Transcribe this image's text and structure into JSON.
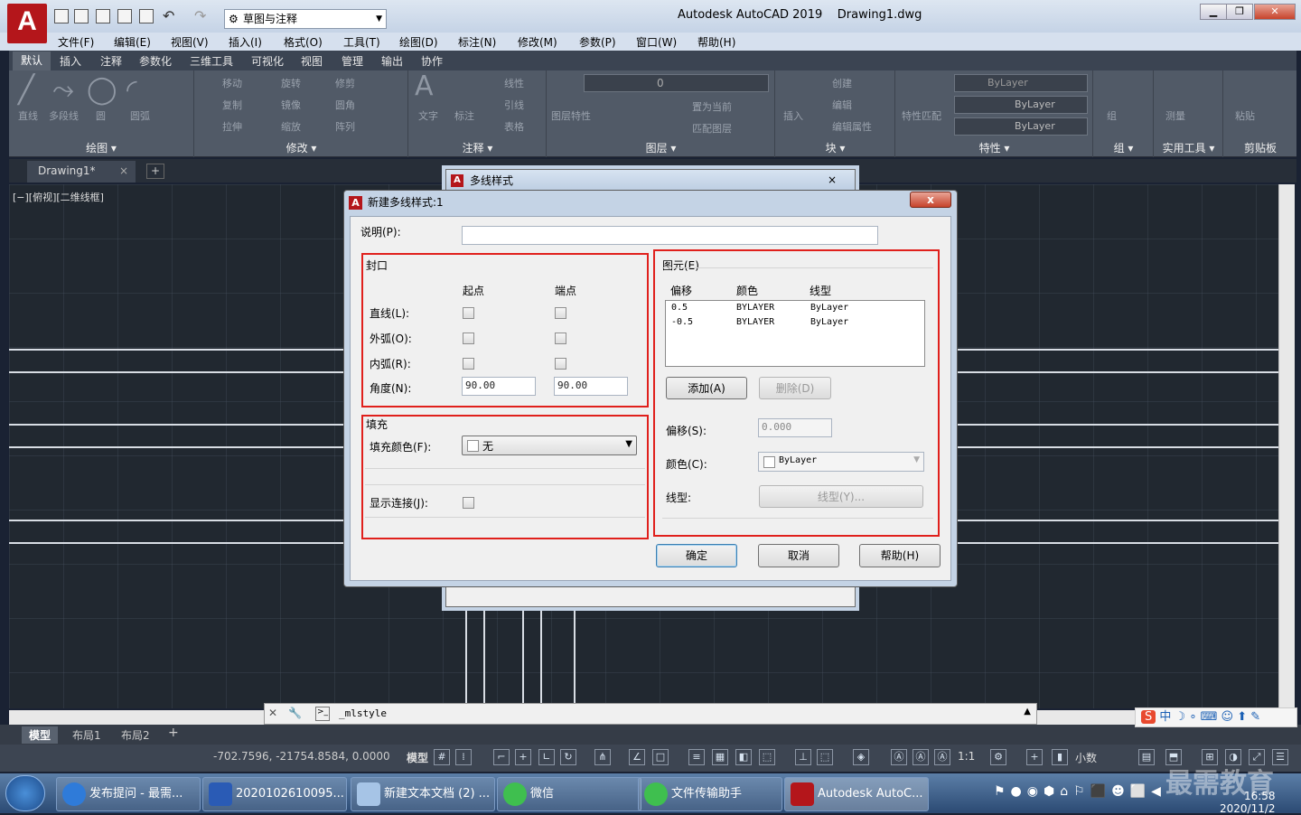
{
  "app": {
    "title": "Autodesk AutoCAD 2019",
    "file": "Drawing1.dwg",
    "logo": "A",
    "workspace": "草图与注释"
  },
  "menu": [
    "文件(F)",
    "编辑(E)",
    "视图(V)",
    "插入(I)",
    "格式(O)",
    "工具(T)",
    "绘图(D)",
    "标注(N)",
    "修改(M)",
    "参数(P)",
    "窗口(W)",
    "帮助(H)"
  ],
  "ribbon_tabs": [
    "默认",
    "插入",
    "注释",
    "参数化",
    "三维工具",
    "可视化",
    "视图",
    "管理",
    "输出",
    "协作"
  ],
  "ribbon_panels": {
    "draw": {
      "title": "绘图",
      "items": [
        "直线",
        "多段线",
        "圆",
        "圆弧"
      ]
    },
    "modify": {
      "title": "修改",
      "items": [
        "移动",
        "旋转",
        "修剪",
        "复制",
        "镜像",
        "圆角",
        "拉伸",
        "缩放",
        "阵列"
      ]
    },
    "annotation": {
      "title": "注释",
      "items": [
        "文字",
        "标注",
        "线性",
        "引线",
        "表格"
      ]
    },
    "layers": {
      "title": "图层",
      "current": "0",
      "items": [
        "图层特性",
        "置为当前",
        "匹配图层"
      ]
    },
    "block": {
      "title": "块",
      "items": [
        "插入",
        "创建",
        "编辑",
        "编辑属性"
      ]
    },
    "properties": {
      "title": "特性",
      "items": [
        "特性匹配",
        "ByLayer",
        "ByLayer",
        "ByLayer"
      ]
    },
    "groups": {
      "title": "组",
      "items": [
        "组"
      ]
    },
    "utilities": {
      "title": "实用工具",
      "items": [
        "测量"
      ]
    },
    "clipboard": {
      "title": "剪贴板",
      "items": [
        "粘贴"
      ]
    }
  },
  "doc_tab": {
    "name": "Drawing1*",
    "close": "×",
    "add": "+"
  },
  "viewport_label": "[−][俯视][二维线框]",
  "back_dialog": {
    "title": "多线样式",
    "close": "×"
  },
  "dialog": {
    "title": "新建多线样式:1",
    "close": "x",
    "description_label": "说明(P):",
    "description_value": "",
    "caps": {
      "group": "封口",
      "col_start": "起点",
      "col_end": "端点",
      "line": "直线(L):",
      "outer_arc": "外弧(O):",
      "inner_arc": "内弧(R):",
      "angle": "角度(N):",
      "angle_start": "90.00",
      "angle_end": "90.00"
    },
    "fill": {
      "group": "填充",
      "color_label": "填充颜色(F):",
      "color_value": "无",
      "show_joints": "显示连接(J):"
    },
    "elements": {
      "group": "图元(E)",
      "headers": [
        "偏移",
        "颜色",
        "线型"
      ],
      "rows": [
        [
          "0.5",
          "BYLAYER",
          "ByLayer"
        ],
        [
          "-0.5",
          "BYLAYER",
          "ByLayer"
        ]
      ],
      "add": "添加(A)",
      "delete": "删除(D)",
      "offset_label": "偏移(S):",
      "offset_value": "0.000",
      "color_label": "颜色(C):",
      "color_value": "ByLayer",
      "linetype_label": "线型:",
      "linetype_button": "线型(Y)..."
    },
    "ok": "确定",
    "cancel": "取消",
    "help": "帮助(H)"
  },
  "command_line": "_mlstyle",
  "layout_tabs": [
    "模型",
    "布局1",
    "布局2"
  ],
  "status": {
    "coords": "-702.7596, -21754.8584, 0.0000",
    "model": "模型",
    "scale": "1:1",
    "units": "小数"
  },
  "taskbar": [
    {
      "label": "发布提问 - 最需..."
    },
    {
      "label": "2020102610095..."
    },
    {
      "label": "新建文本文档 (2) ..."
    },
    {
      "label": "微信"
    },
    {
      "label": "文件传输助手"
    },
    {
      "label": "Autodesk AutoC..."
    }
  ],
  "clock": {
    "time": "16:58",
    "date": "2020/11/2"
  },
  "watermark": "最需教育",
  "ime": "中"
}
